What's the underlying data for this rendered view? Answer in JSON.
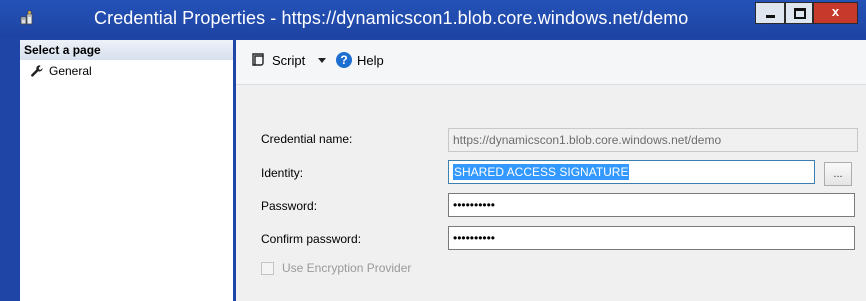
{
  "window": {
    "title": "Credential Properties - https://dynamicscon1.blob.core.windows.net/demo",
    "close_glyph": "x"
  },
  "sidebar": {
    "header": "Select a page",
    "items": [
      {
        "label": "General",
        "icon": "wrench-icon"
      }
    ]
  },
  "toolbar": {
    "script_label": "Script",
    "help_label": "Help",
    "help_glyph": "?"
  },
  "form": {
    "credential_name": {
      "label": "Credential name:",
      "value": "https://dynamicscon1.blob.core.windows.net/demo"
    },
    "identity": {
      "label": "Identity:",
      "value": "SHARED ACCESS SIGNATURE",
      "browse_label": "..."
    },
    "password": {
      "label": "Password:",
      "value": "••••••••••"
    },
    "confirm_password": {
      "label": "Confirm password:",
      "value": "••••••••••"
    },
    "encryption": {
      "label": "Use Encryption Provider",
      "checked": false
    }
  },
  "colors": {
    "title_bar": "#1e44a3",
    "selection": "#3399ff",
    "close_button": "#c7392b"
  }
}
